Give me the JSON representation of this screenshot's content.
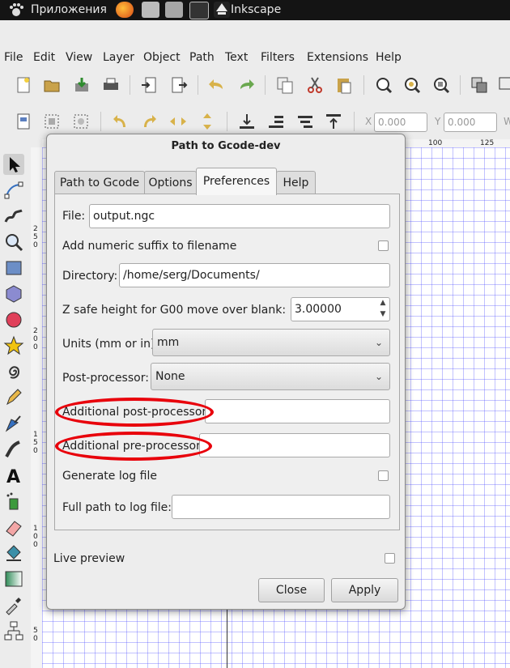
{
  "panel": {
    "apps_label": "Приложения",
    "task_label": "Inkscape",
    "icons": [
      "gnome-foot-icon",
      "firefox-icon",
      "files-icon",
      "calculator-icon",
      "terminal-icon",
      "inkscape-icon"
    ]
  },
  "menubar": [
    "File",
    "Edit",
    "View",
    "Layer",
    "Object",
    "Path",
    "Text",
    "Filters",
    "Extensions",
    "Help"
  ],
  "toolbar2": {
    "x_label": "X",
    "x_value": "0.000",
    "y_label": "Y",
    "y_value": "0.000",
    "w_label": "W"
  },
  "ruler": {
    "h_ticks": [
      "100",
      "125"
    ],
    "v_ticks": [
      "2",
      "5",
      "0",
      "2",
      "0",
      "0",
      "1",
      "5",
      "0",
      "1",
      "0",
      "0",
      "5",
      "0"
    ]
  },
  "dialog": {
    "title": "Path to Gcode-dev",
    "tabs": [
      "Path to Gcode",
      "Options",
      "Preferences",
      "Help"
    ],
    "active_tab": "Preferences",
    "file_label": "File:",
    "file_value": "output.ngc",
    "numeric_suffix_label": "Add numeric suffix to filename",
    "directory_label": "Directory:",
    "directory_value": "/home/serg/Documents/",
    "z_safe_label": "Z safe height for G00 move over blank:",
    "z_safe_value": "3.00000",
    "units_label": "Units (mm or in):",
    "units_value": "mm",
    "postproc_label": "Post-processor:",
    "postproc_value": "None",
    "add_post_label": "Additional post-processor:",
    "add_post_value": "",
    "add_pre_label": "Additional pre-processor:",
    "add_pre_value": "",
    "log_label": "Generate log file",
    "log_path_label": "Full path to log file:",
    "log_path_value": "",
    "live_preview_label": "Live preview",
    "close_label": "Close",
    "apply_label": "Apply"
  },
  "colors": {
    "annotation": "#e8000b",
    "grid": "#5050ff"
  }
}
